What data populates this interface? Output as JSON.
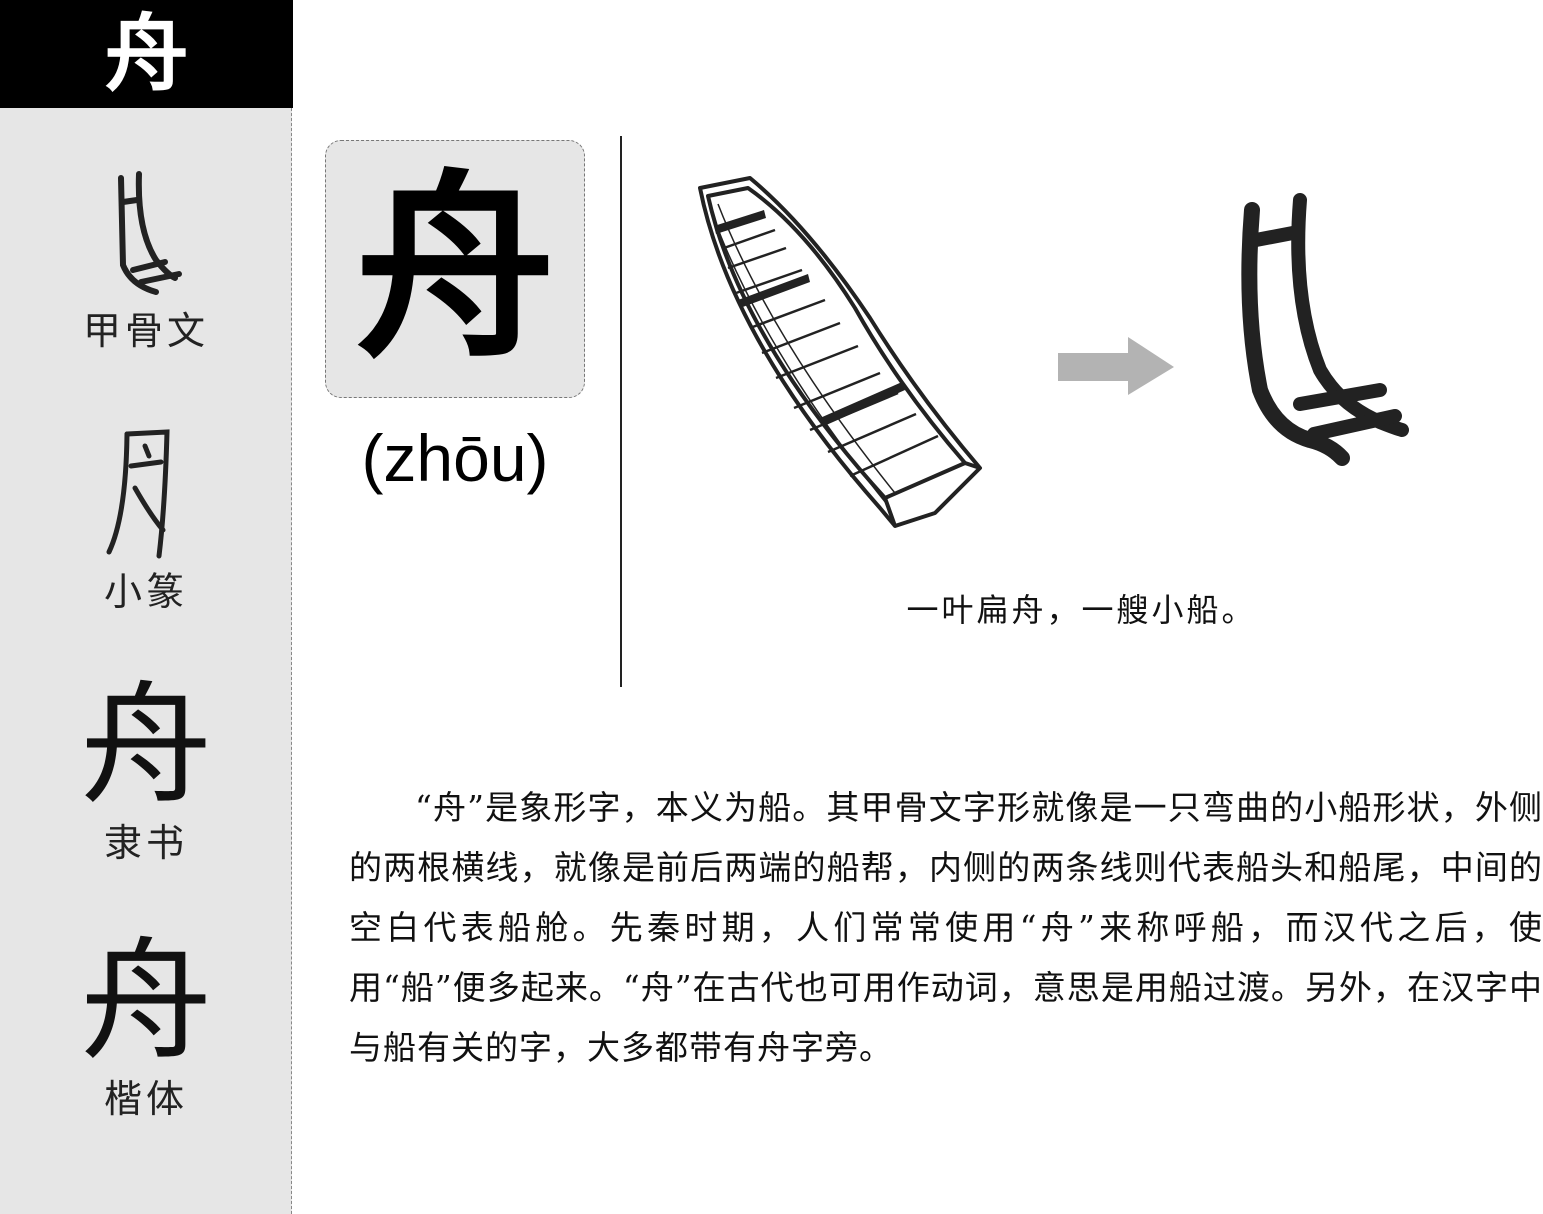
{
  "header": {
    "character": "舟"
  },
  "sidebar": {
    "forms": [
      {
        "label": "甲骨文"
      },
      {
        "label": "小篆"
      },
      {
        "label": "隶书",
        "glyph": "舟"
      },
      {
        "label": "楷体",
        "glyph": "舟"
      }
    ]
  },
  "main": {
    "character": "舟",
    "pinyin": "(zhōu)",
    "caption": "一叶扁舟，一艘小船。",
    "paragraph": "“舟”是象形字，本义为船。其甲骨文字形就像是一只弯曲的小船形状，外侧的两根横线，就像是前后两端的船帮，内侧的两条线则代表船头和船尾，中间的空白代表船舱。先秦时期，人们常常使用“舟”来称呼船，而汉代之后，使用“船”便多起来。“舟”在古代也可用作动词，意思是用船过渡。另外，在汉字中与船有关的字，大多都带有舟字旁。"
  },
  "colors": {
    "sidebar_bg": "#e6e6e6",
    "header_bg": "#000000",
    "arrow": "#b3b3b3"
  }
}
